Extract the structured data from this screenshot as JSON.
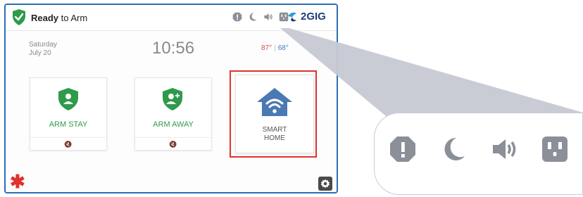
{
  "header": {
    "status_bold": "Ready",
    "status_rest": " to Arm",
    "brand": "2GIG"
  },
  "info": {
    "day": "Saturday",
    "date": "July 20",
    "time": "10:56",
    "temp_high": "87°",
    "temp_sep": "|",
    "temp_low": "68°"
  },
  "tiles": {
    "arm_stay": {
      "label": "ARM STAY",
      "sub": "🔇"
    },
    "arm_away": {
      "label": "ARM AWAY",
      "sub": "🔇"
    },
    "smart_home": {
      "line1": "SMART",
      "line2": "HOME"
    }
  },
  "icons": [
    "alert-icon",
    "moon-icon",
    "speaker-icon",
    "outlet-icon"
  ],
  "colors": {
    "green": "#2f9a4a",
    "highlight_red": "#e0322e",
    "frame_blue": "#2a6fb8",
    "house_blue": "#4a79b3",
    "icon_gray": "#8b8f98",
    "callout_gray": "#c6c9d3"
  }
}
